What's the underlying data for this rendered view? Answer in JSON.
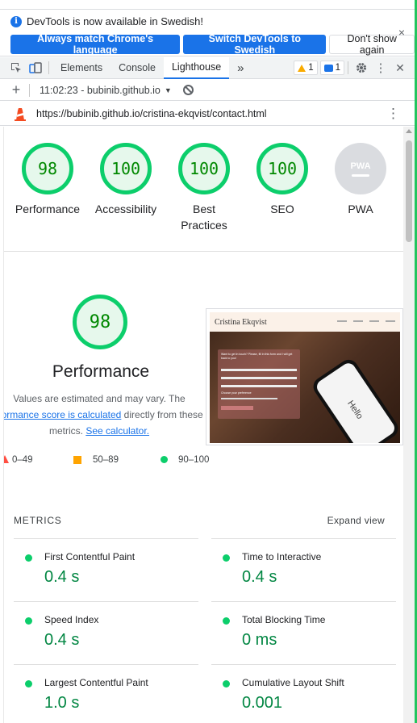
{
  "infobar": {
    "message": "DevTools is now available in Swedish!",
    "buttons": [
      "Always match Chrome's language",
      "Switch DevTools to Swedish",
      "Don't show again"
    ],
    "close": "×"
  },
  "tabs": {
    "items": [
      "Elements",
      "Console",
      "Lighthouse"
    ],
    "active": "Lighthouse",
    "more": "»",
    "warnings": "1",
    "messages": "1"
  },
  "lighthouse_toolbar": {
    "plus": "+",
    "report_label": "11:02:23 - bubinib.github.io",
    "dropdown": "▼"
  },
  "url": {
    "value": "https://bubinib.github.io/cristina-ekqvist/contact.html",
    "menu": "⋮"
  },
  "scores": [
    {
      "label": "Performance",
      "value": "98"
    },
    {
      "label": "Accessibility",
      "value": "100"
    },
    {
      "label": "Best Practices",
      "value": "100"
    },
    {
      "label": "SEO",
      "value": "100"
    },
    {
      "label": "PWA",
      "value": "PWA"
    }
  ],
  "performance": {
    "score": "98",
    "title": "Performance",
    "note_1": "Values are estimated and may vary. The",
    "note_link_1": "rformance score is calculated",
    "note_2": " directly from these",
    "note_3": "metrics. ",
    "note_link_2": "See calculator."
  },
  "screenshot": {
    "site_name": "Cristina Ekqvist",
    "form_text": "Want to get in touch? Please, fill in this form and I will get back to you!",
    "pref": "Choose your preference",
    "phone_text": "Hello"
  },
  "legend": {
    "fail": "0–49",
    "average": "50–89",
    "pass": "90–100"
  },
  "metrics": {
    "heading": "METRICS",
    "expand": "Expand view",
    "items": [
      {
        "name": "First Contentful Paint",
        "value": "0.4 s"
      },
      {
        "name": "Time to Interactive",
        "value": "0.4 s"
      },
      {
        "name": "Speed Index",
        "value": "0.4 s"
      },
      {
        "name": "Total Blocking Time",
        "value": "0 ms"
      },
      {
        "name": "Largest Contentful Paint",
        "value": "1.0 s"
      },
      {
        "name": "Cumulative Layout Shift",
        "value": "0.001"
      }
    ]
  },
  "colors": {
    "pass": "#0cce6b",
    "pass_text": "#018642",
    "average": "#ffa400",
    "accent": "#1a73e8"
  }
}
